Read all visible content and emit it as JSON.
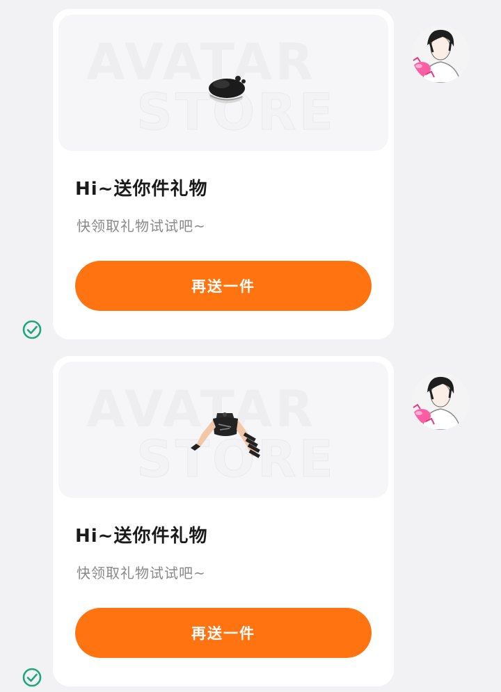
{
  "messages": [
    {
      "watermark_top": "AVATAR",
      "watermark_bottom": "STORE",
      "gift_item_icon": "beret-hat-icon",
      "title": "Hi~送你件礼物",
      "subtitle": "快领取礼物试试吧~",
      "button_label": "再送一件",
      "avatar_icon": "user-avatar-icon",
      "status_icon": "sent-check-icon"
    },
    {
      "watermark_top": "AVATAR",
      "watermark_bottom": "STORE",
      "gift_item_icon": "crop-top-outfit-icon",
      "title": "Hi~送你件礼物",
      "subtitle": "快领取礼物试试吧~",
      "button_label": "再送一件",
      "avatar_icon": "user-avatar-icon",
      "status_icon": "sent-check-icon"
    }
  ],
  "colors": {
    "accent": "#ff7411",
    "status_check": "#1aa77a",
    "background": "#f2f2f4"
  }
}
